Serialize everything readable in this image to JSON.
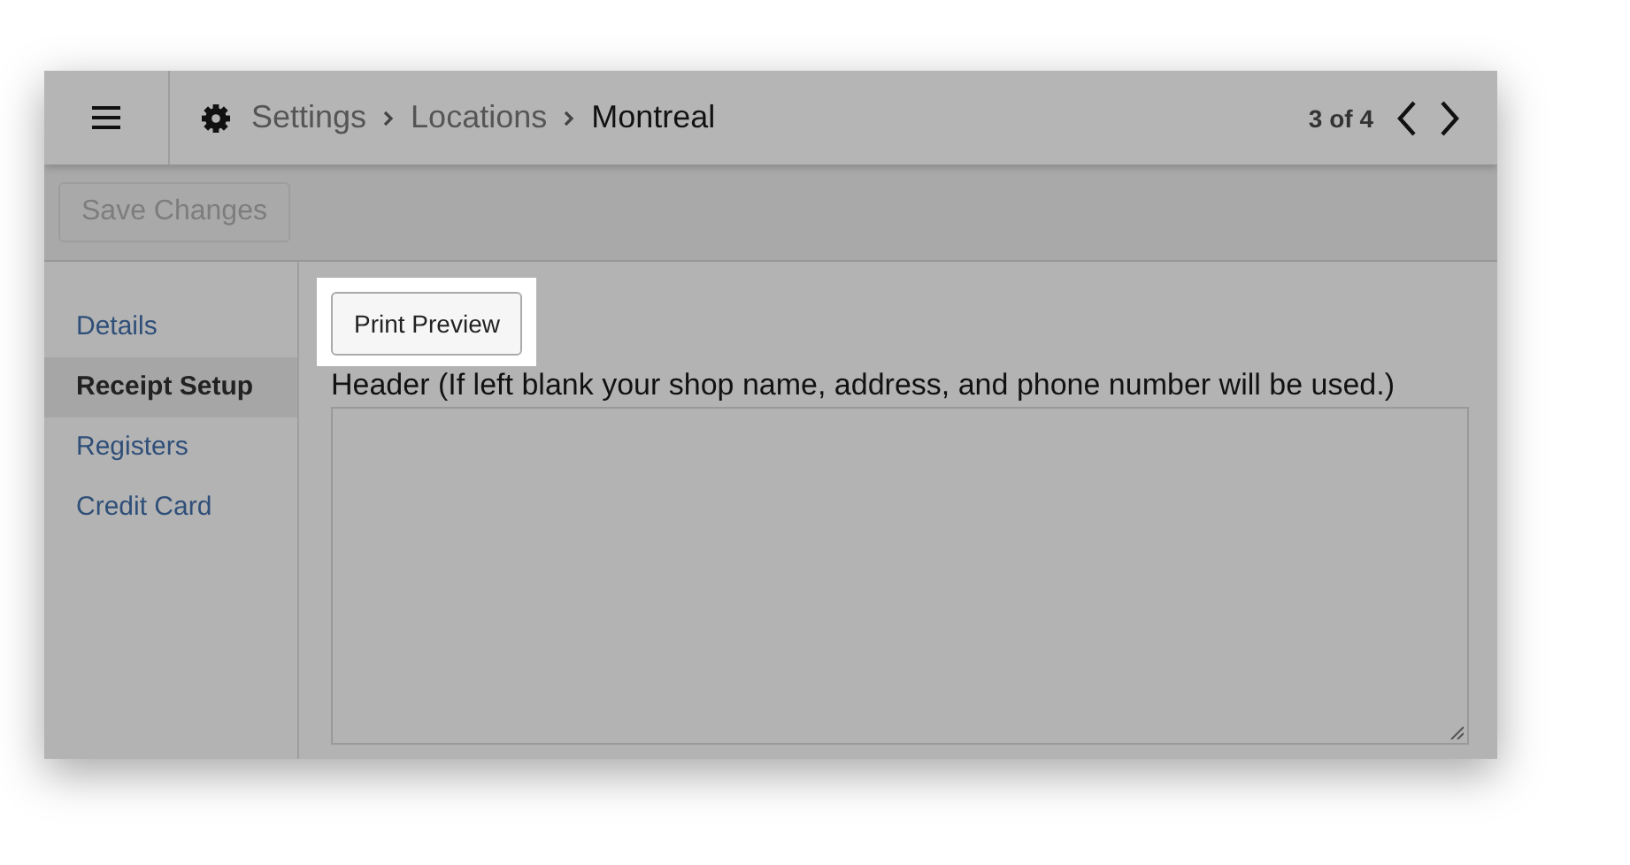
{
  "breadcrumbs": [
    {
      "label": "Settings",
      "current": false
    },
    {
      "label": "Locations",
      "current": false
    },
    {
      "label": "Montreal",
      "current": true
    }
  ],
  "pager": {
    "text": "3 of 4"
  },
  "toolbar": {
    "save_button": {
      "label": "Save Changes",
      "disabled": true
    }
  },
  "sidebar": {
    "items": [
      {
        "label": "Details",
        "selected": false
      },
      {
        "label": "Receipt Setup",
        "selected": true
      },
      {
        "label": "Registers",
        "selected": false
      },
      {
        "label": "Credit Card",
        "selected": false
      }
    ]
  },
  "content": {
    "preview_button": {
      "label": "Print Preview",
      "highlighted": true
    },
    "header_field": {
      "label": "Header (If left blank your shop name, address, and phone number will be used.)"
    }
  }
}
